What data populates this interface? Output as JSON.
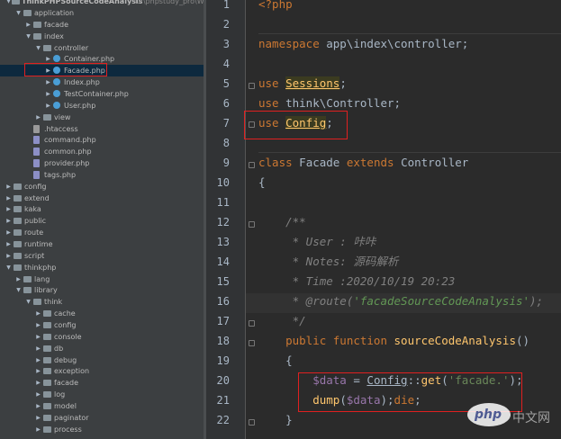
{
  "project_tree": {
    "root_label": "ThinkPHPSourceCodeAnalysis",
    "root_path": "D:\\phpstudy_pro\\WWW\\...",
    "items": [
      {
        "label": "application",
        "kind": "folder",
        "expanded": true
      },
      {
        "label": "facade",
        "kind": "folder",
        "expanded": false
      },
      {
        "label": "index",
        "kind": "folder",
        "expanded": true
      },
      {
        "label": "controller",
        "kind": "folder",
        "expanded": true
      },
      {
        "label": "Container.php",
        "kind": "php",
        "expanded": false
      },
      {
        "label": "Facade.php",
        "kind": "php",
        "expanded": false,
        "selected": true
      },
      {
        "label": "Index.php",
        "kind": "php",
        "expanded": false
      },
      {
        "label": "TestContainer.php",
        "kind": "php",
        "expanded": false
      },
      {
        "label": "User.php",
        "kind": "php",
        "expanded": false
      },
      {
        "label": "view",
        "kind": "folder",
        "expanded": false
      },
      {
        "label": ".htaccess",
        "kind": "file"
      },
      {
        "label": "command.php",
        "kind": "phpfile"
      },
      {
        "label": "common.php",
        "kind": "phpfile"
      },
      {
        "label": "provider.php",
        "kind": "phpfile"
      },
      {
        "label": "tags.php",
        "kind": "phpfile"
      },
      {
        "label": "config",
        "kind": "folder",
        "expanded": false
      },
      {
        "label": "extend",
        "kind": "folder",
        "expanded": false
      },
      {
        "label": "kaka",
        "kind": "folder",
        "expanded": false
      },
      {
        "label": "public",
        "kind": "folder",
        "expanded": false
      },
      {
        "label": "route",
        "kind": "folder",
        "expanded": false
      },
      {
        "label": "runtime",
        "kind": "folder",
        "expanded": false
      },
      {
        "label": "script",
        "kind": "folder",
        "expanded": false
      },
      {
        "label": "thinkphp",
        "kind": "folder",
        "expanded": true
      },
      {
        "label": "lang",
        "kind": "folder",
        "expanded": false
      },
      {
        "label": "library",
        "kind": "folder",
        "expanded": true
      },
      {
        "label": "think",
        "kind": "folder",
        "expanded": true
      },
      {
        "label": "cache",
        "kind": "folder",
        "expanded": false
      },
      {
        "label": "config",
        "kind": "folder",
        "expanded": false
      },
      {
        "label": "console",
        "kind": "folder",
        "expanded": false
      },
      {
        "label": "db",
        "kind": "folder",
        "expanded": false
      },
      {
        "label": "debug",
        "kind": "folder",
        "expanded": false
      },
      {
        "label": "exception",
        "kind": "folder",
        "expanded": false
      },
      {
        "label": "facade",
        "kind": "folder",
        "expanded": false
      },
      {
        "label": "log",
        "kind": "folder",
        "expanded": false
      },
      {
        "label": "model",
        "kind": "folder",
        "expanded": false
      },
      {
        "label": "paginator",
        "kind": "folder",
        "expanded": false
      },
      {
        "label": "process",
        "kind": "folder",
        "expanded": false
      }
    ]
  },
  "editor": {
    "line_numbers": [
      "1",
      "2",
      "3",
      "4",
      "5",
      "6",
      "7",
      "8",
      "9",
      "10",
      "11",
      "12",
      "13",
      "14",
      "15",
      "16",
      "17",
      "18",
      "19",
      "20",
      "21",
      "22"
    ],
    "lines": {
      "l1": "<?php",
      "l3_kw": "namespace",
      "l3_rest": " app\\index\\controller;",
      "l5_kw": "use",
      "l5_cls": "Sessions",
      "l5_end": ";",
      "l6_kw": "use",
      "l6_rest": " think\\Controller;",
      "l7_kw": "use",
      "l7_cls": "Config",
      "l7_end": ";",
      "l9_kw": "class",
      "l9_name": " Facade ",
      "l9_ext": "extends",
      "l9_parent": " Controller",
      "l10": "{",
      "l12": "    /**",
      "l13": "     * User : 咔咔",
      "l14": "     * Notes: 源码解析",
      "l15": "     * Time :2020/10/19 20:23",
      "l16_pre": "     * @route(",
      "l16_str": "'facadeSourceCodeAnalysis'",
      "l16_end": ");",
      "l17": "     */",
      "l18_kw": "    public function",
      "l18_fn": " sourceCodeAnalysis",
      "l18_end": "()",
      "l19": "    {",
      "l20_var": "        $data",
      "l20_eq": " = ",
      "l20_cls": "Config",
      "l20_op": "::",
      "l20_fn": "get",
      "l20_str": "'facade.'",
      "l20_end": ");",
      "l21_fn": "        dump",
      "l21_var": "$data",
      "l21_mid": ");",
      "l21_die": "die",
      "l21_end": ";",
      "l22": "    }"
    }
  },
  "watermark": {
    "brand": "php",
    "suffix": "中文网"
  },
  "colors": {
    "highlight_box": "#e02020",
    "keyword": "#cc7832",
    "string": "#6a8759",
    "comment": "#629755",
    "variable": "#9876aa",
    "function": "#ffc66d"
  }
}
